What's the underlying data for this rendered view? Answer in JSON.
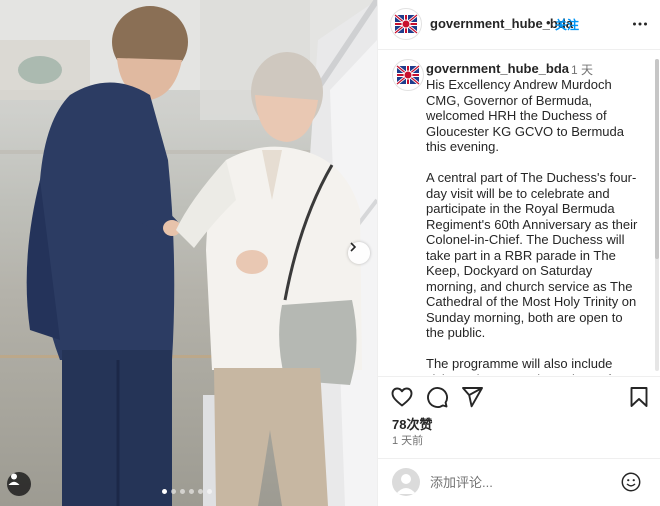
{
  "post": {
    "username": "government_hube_bda",
    "follow_label": "关注",
    "separator": "•",
    "more_icon": "more-horizontal-icon"
  },
  "caption": {
    "username": "government_hube_bda",
    "time": "1 天",
    "paragraphs": [
      "His Excellency Andrew Murdoch CMG, Governor of Bermuda, welcomed HRH the Duchess of Gloucester KG GCVO to Bermuda this evening.",
      "A central part of The Duchess's four-day visit will be to celebrate and participate in the Royal Bermuda Regiment's 60th Anniversary as their Colonel-in-Chief. The Duchess will take part in a RBR parade in The Keep, Dockyard on Saturday morning, and church service as The Cathedral of the Most Holy Trinity on Sunday morning, both are open to the public.",
      "The programme will also include visits to the Bermuda Institute of"
    ]
  },
  "stats": {
    "likes": "78次赞",
    "posted": "1 天前"
  },
  "comment": {
    "placeholder": "添加评论..."
  },
  "media": {
    "slide_count": 6,
    "active_slide": 0
  },
  "colors": {
    "accent": "#0095f6",
    "text": "#262626",
    "muted": "#737373",
    "border": "#efefef"
  }
}
